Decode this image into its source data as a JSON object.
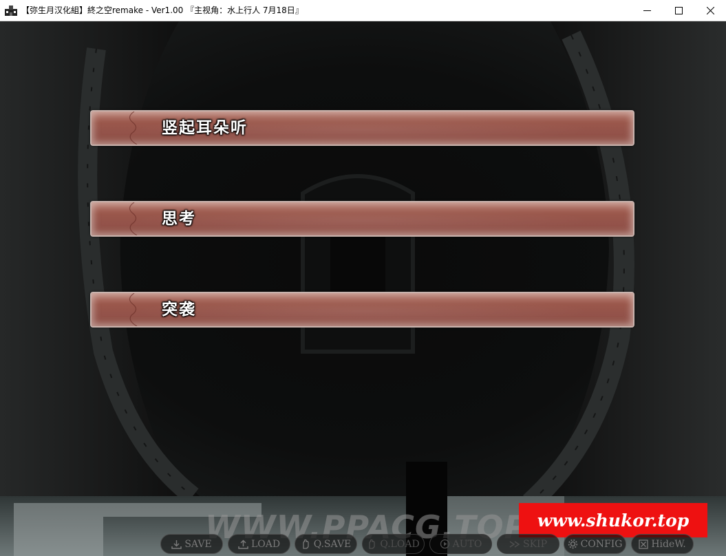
{
  "window": {
    "title": "【弥生月汉化組】終之空remake - Ver1.00 『主视角：水上行人 7月18日』",
    "controls": [
      "minimize",
      "maximize",
      "close"
    ]
  },
  "choices": [
    {
      "label": "竖起耳朵听"
    },
    {
      "label": "思考"
    },
    {
      "label": "突袭"
    }
  ],
  "watermark": "WWW.PPACG.TOP",
  "promo_banner": {
    "text": "www.shukor.top",
    "color": "#ee1111"
  },
  "menu": {
    "save": {
      "label": "SAVE",
      "icon": "save-icon"
    },
    "load": {
      "label": "LOAD",
      "icon": "load-icon"
    },
    "qsave": {
      "label": "Q.SAVE",
      "icon": "hand-icon"
    },
    "qload": {
      "label": "Q.LOAD",
      "icon": "hand-icon"
    },
    "auto": {
      "label": "AUTO",
      "icon": "play-icon"
    },
    "skip": {
      "label": "SKIP",
      "icon": "fast-forward-icon"
    },
    "config": {
      "label": "CONFIG",
      "icon": "gear-icon"
    },
    "hide": {
      "label": "HideW.",
      "icon": "box-x-icon"
    }
  },
  "colors": {
    "choice_fill": "#9a574b",
    "choice_border": "#c9b3ad",
    "menu_text": "#7a7a7a"
  }
}
